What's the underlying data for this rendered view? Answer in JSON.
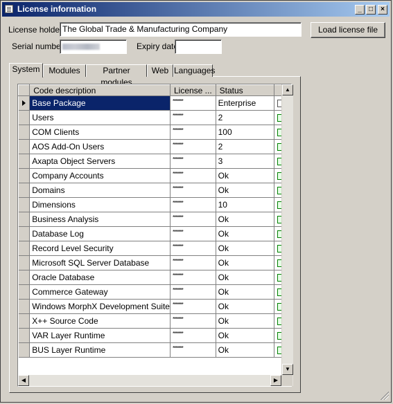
{
  "window": {
    "title": "License information",
    "minimize": "_",
    "maximize": "□",
    "close": "×"
  },
  "form": {
    "license_holder_label": "License holder",
    "license_holder_value": "The Global Trade & Manufacturing Company",
    "serial_number_label": "Serial number",
    "expiry_date_label": "Expiry date",
    "expiry_date_value": "",
    "load_button": "Load license file"
  },
  "tabs": [
    {
      "label": "System",
      "active": true
    },
    {
      "label": "Modules",
      "active": false
    },
    {
      "label": "Partner modules",
      "active": false
    },
    {
      "label": "Web",
      "active": false
    },
    {
      "label": "Languages",
      "active": false
    }
  ],
  "grid": {
    "columns": [
      "Code description",
      "License ...",
      "Status"
    ],
    "rows": [
      {
        "desc": "Base Package",
        "license": "*******",
        "status": "Enterprise"
      },
      {
        "desc": "Users",
        "license": "*******",
        "status": "2"
      },
      {
        "desc": "COM Clients",
        "license": "*******",
        "status": "100"
      },
      {
        "desc": "AOS Add-On Users",
        "license": "*******",
        "status": "2"
      },
      {
        "desc": "Axapta Object Servers",
        "license": "*******",
        "status": "3"
      },
      {
        "desc": "Company Accounts",
        "license": "*******",
        "status": "Ok"
      },
      {
        "desc": "Domains",
        "license": "*******",
        "status": "Ok"
      },
      {
        "desc": "Dimensions",
        "license": "*******",
        "status": "10"
      },
      {
        "desc": "Business Analysis",
        "license": "*******",
        "status": "Ok"
      },
      {
        "desc": "Database Log",
        "license": "*******",
        "status": "Ok"
      },
      {
        "desc": "Record Level Security",
        "license": "*******",
        "status": "Ok"
      },
      {
        "desc": "Microsoft SQL Server Database",
        "license": "*******",
        "status": "Ok"
      },
      {
        "desc": "Oracle Database",
        "license": "*******",
        "status": "Ok"
      },
      {
        "desc": "Commerce Gateway",
        "license": "*******",
        "status": "Ok"
      },
      {
        "desc": "Windows MorphX Development Suite",
        "license": "*******",
        "status": "Ok"
      },
      {
        "desc": "X++ Source Code",
        "license": "*******",
        "status": "Ok"
      },
      {
        "desc": "VAR Layer Runtime",
        "license": "*******",
        "status": "Ok"
      },
      {
        "desc": "BUS Layer Runtime",
        "license": "*******",
        "status": "Ok"
      }
    ],
    "selected_row": 0,
    "row_icon": "license-code-icon"
  },
  "colors": {
    "titlebar_start": "#0a246a",
    "titlebar_end": "#a6caf0",
    "selection": "#0a246a",
    "face": "#d4d0c8"
  }
}
